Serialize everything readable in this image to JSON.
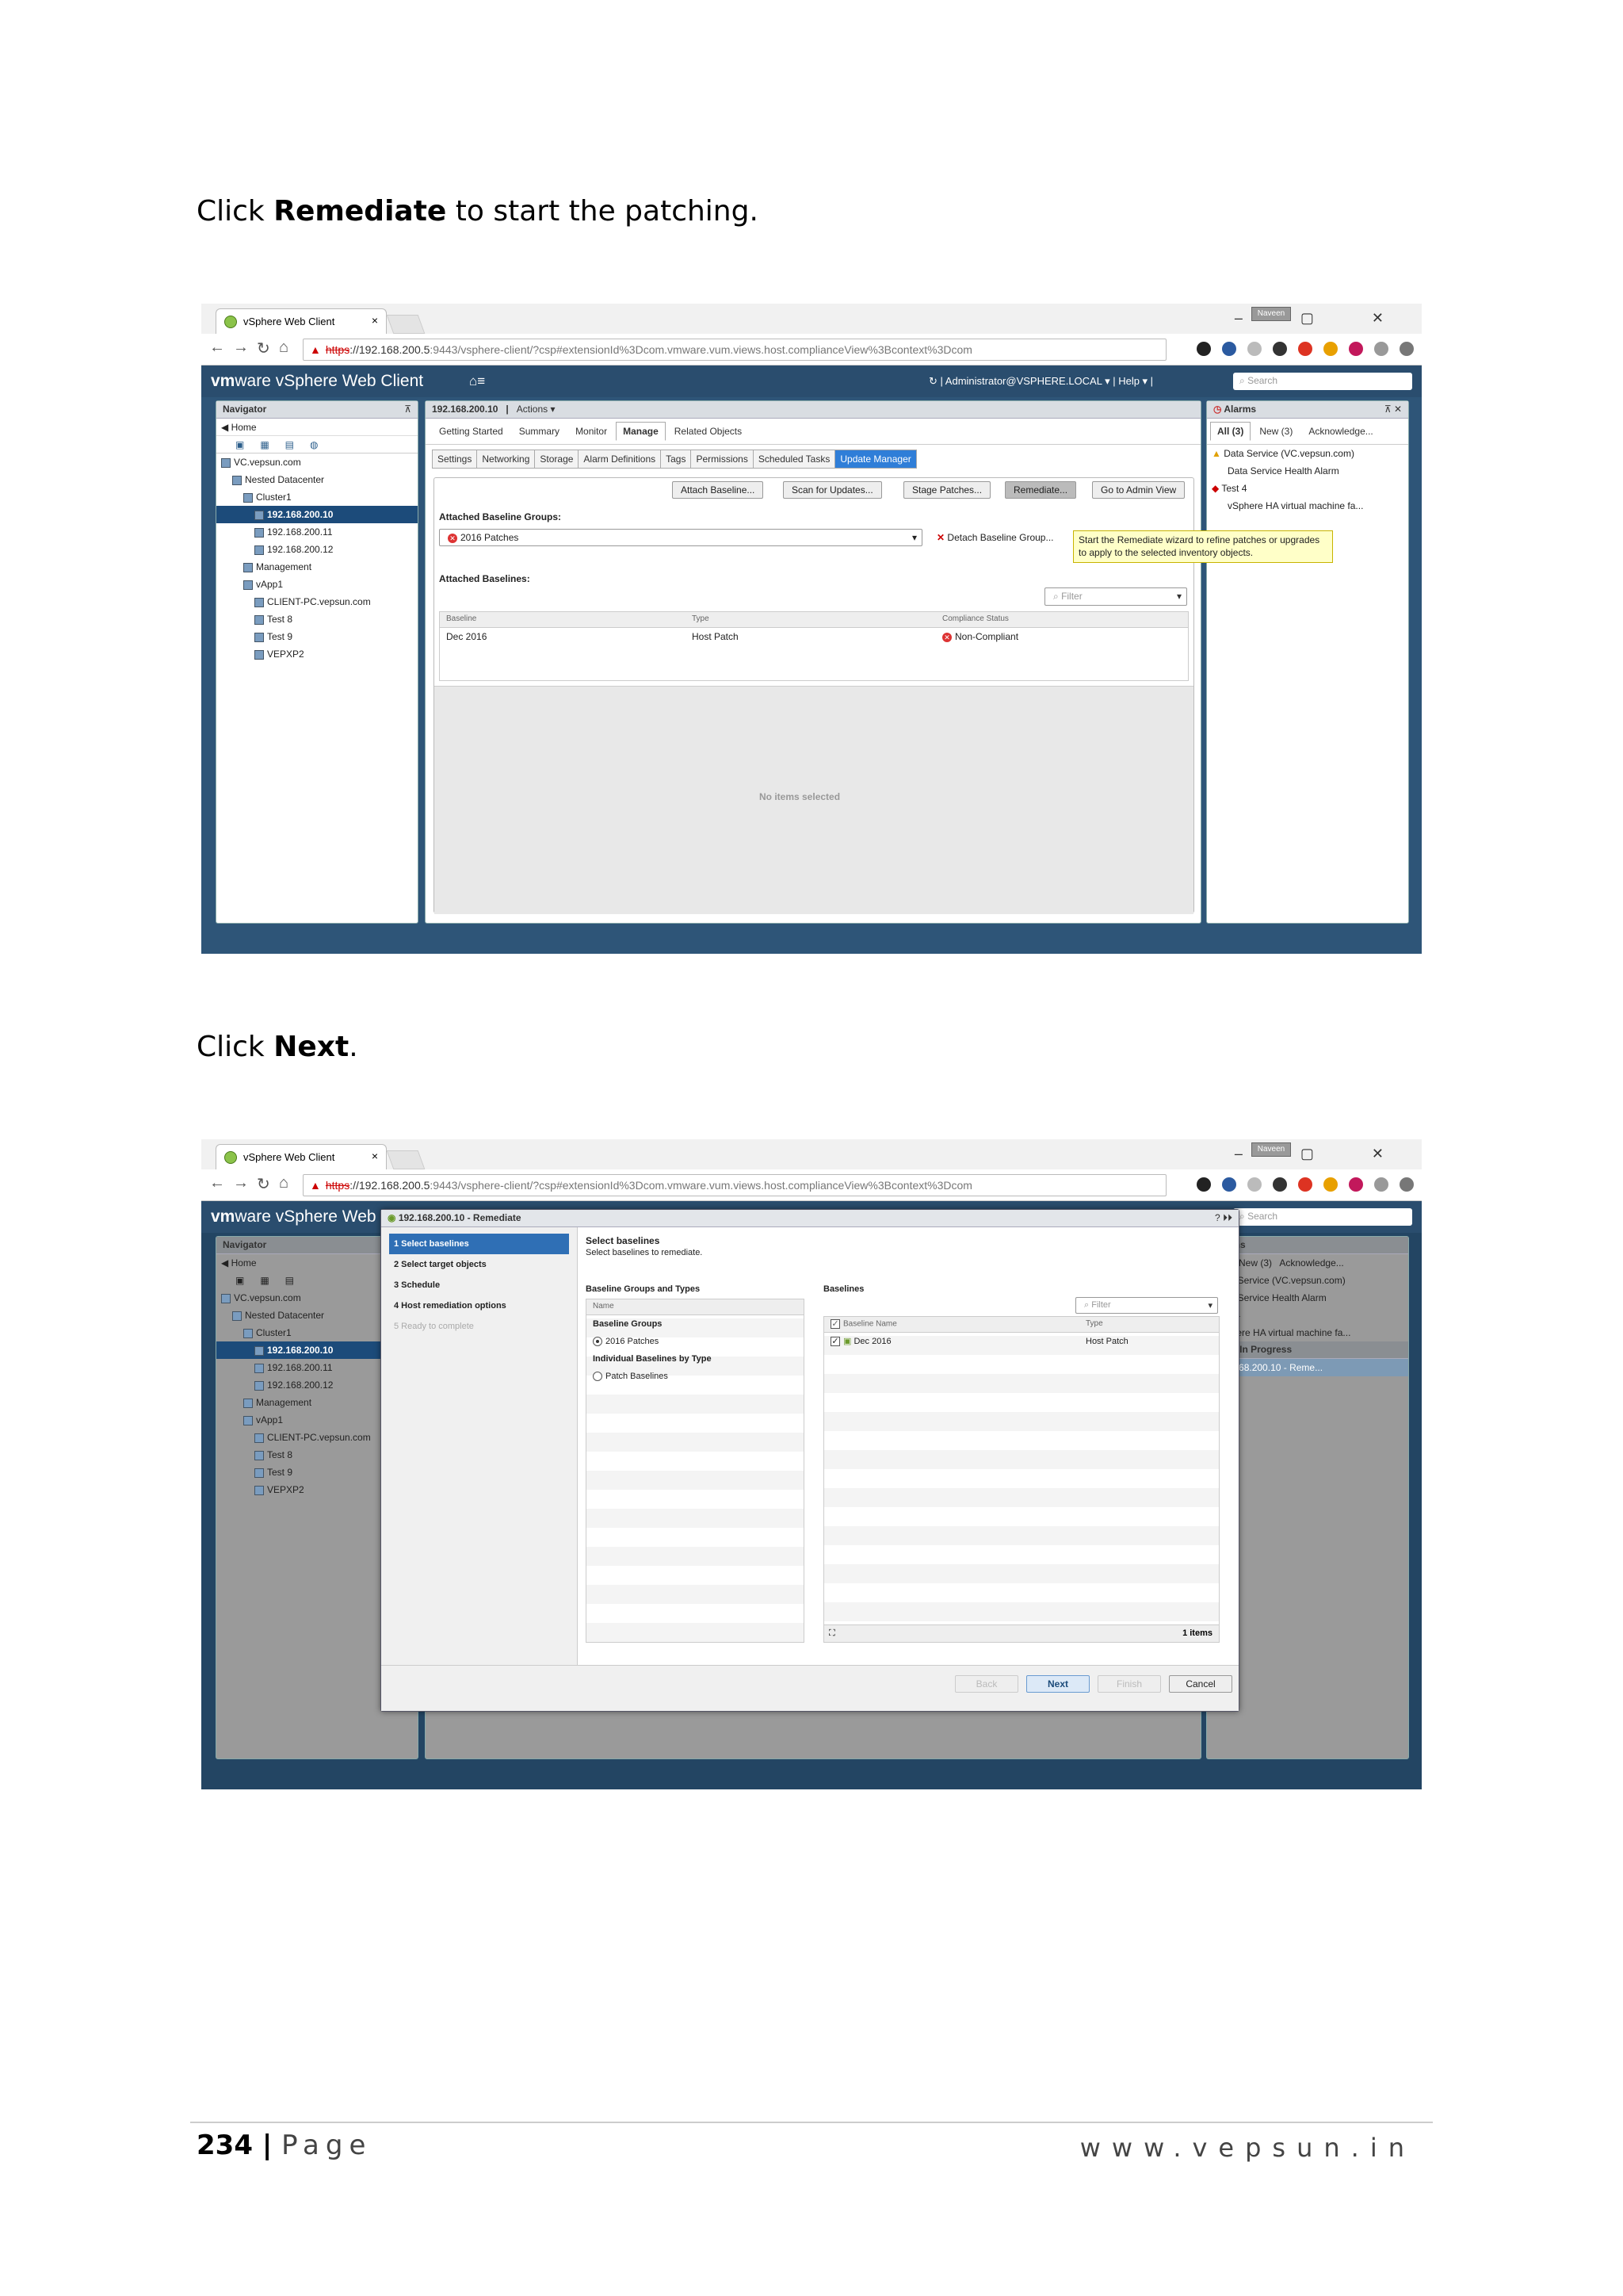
{
  "instructions": {
    "step1_prefix": "Click ",
    "step1_bold": "Remediate",
    "step1_suffix": " to start the patching.",
    "step2_prefix": "Click ",
    "step2_bold": "Next",
    "step2_suffix": "."
  },
  "browser": {
    "tab_title": "vSphere Web Client",
    "tab_close": "×",
    "url_warn": "▲",
    "url_https": "https",
    "url_host": "://192.168.200.5",
    "url_rest": ":9443/vsphere-client/?csp#extensionId%3Dcom.vmware.vum.views.host.complianceView%3Bcontext%3Dcom",
    "profile": "Naveen",
    "window_controls": "–  ▢  ✕"
  },
  "vsphere": {
    "logo_vm": "vm",
    "logo_ware": "ware",
    "product": " vSphere Web Client",
    "home": "⌂≡",
    "user": "Administrator@VSPHERE.LOCAL ▾  |  Help ▾  |",
    "refresh": "↻  |",
    "search_placeholder": "Search"
  },
  "navigator": {
    "title": "Navigator",
    "home": "◀ Home",
    "tree": [
      {
        "label": "VC.vepsun.com",
        "depth": 0
      },
      {
        "label": "Nested Datacenter",
        "depth": 1
      },
      {
        "label": "Cluster1",
        "depth": 2
      },
      {
        "label": "192.168.200.10",
        "depth": 3,
        "selected": true
      },
      {
        "label": "192.168.200.11",
        "depth": 3
      },
      {
        "label": "192.168.200.12",
        "depth": 3
      },
      {
        "label": "Management",
        "depth": 2
      },
      {
        "label": "vApp1",
        "depth": 2
      },
      {
        "label": "CLIENT-PC.vepsun.com",
        "depth": 3
      },
      {
        "label": "Test 8",
        "depth": 3
      },
      {
        "label": "Test 9",
        "depth": 3
      },
      {
        "label": "VEPXP2",
        "depth": 3
      }
    ]
  },
  "main": {
    "host": "192.168.200.10",
    "actions": "Actions ▾",
    "tabs": [
      "Getting Started",
      "Summary",
      "Monitor",
      "Manage",
      "Related Objects"
    ],
    "active_tab": "Manage",
    "subtabs": [
      "Settings",
      "Networking",
      "Storage",
      "Alarm Definitions",
      "Tags",
      "Permissions",
      "Scheduled Tasks",
      "Update Manager"
    ],
    "active_subtab": "Update Manager",
    "buttons": {
      "attach": "Attach Baseline...",
      "scan": "Scan for Updates...",
      "stage": "Stage Patches...",
      "remediate": "Remediate...",
      "admin": "Go to Admin View"
    },
    "attached_groups_label": "Attached Baseline Groups:",
    "group_value": "2016 Patches",
    "detach": "Detach Baseline Group...",
    "attached_baselines_label": "Attached Baselines:",
    "filter_placeholder": "Filter",
    "columns": [
      "Baseline",
      "Type",
      "Compliance Status"
    ],
    "rows": [
      [
        "Dec 2016",
        "Host Patch",
        "Non-Compliant"
      ]
    ],
    "no_items": "No items selected",
    "tooltip": "Start the Remediate wizard to refine patches or upgrades to apply to the selected inventory objects."
  },
  "alarms": {
    "title": "Alarms",
    "tabs": [
      "All (3)",
      "New (3)",
      "Acknowledge..."
    ],
    "items": [
      "Data Service (VC.vepsun.com)",
      "Data Service Health Alarm",
      "Test 4",
      "vSphere HA virtual machine fa..."
    ],
    "work_title": "Work In Progress",
    "work_item": "192.168.200.10 - Reme..."
  },
  "wizard": {
    "title": "192.168.200.10 - Remediate",
    "steps": [
      "1  Select baselines",
      "2  Select target objects",
      "3  Schedule",
      "4  Host remediation options",
      "5  Ready to complete"
    ],
    "header": "Select baselines",
    "subheader": "Select baselines to remediate.",
    "groups_title": "Baseline Groups and Types",
    "name_col": "Name",
    "group_header": "Baseline Groups",
    "group_item": "2016 Patches",
    "individual_header": "Individual Baselines by Type",
    "individual_item": "Patch Baselines",
    "baselines_title": "Baselines",
    "filter_placeholder": "Filter",
    "bcols": [
      "Baseline Name",
      "Type"
    ],
    "brows": [
      [
        "Dec 2016",
        "Host Patch"
      ]
    ],
    "count": "1 items",
    "buttons": {
      "back": "Back",
      "next": "Next",
      "finish": "Finish",
      "cancel": "Cancel"
    }
  },
  "footer": {
    "page": "234",
    "sep": " | ",
    "page_word": "Page",
    "site": "www.vepsun.in"
  }
}
